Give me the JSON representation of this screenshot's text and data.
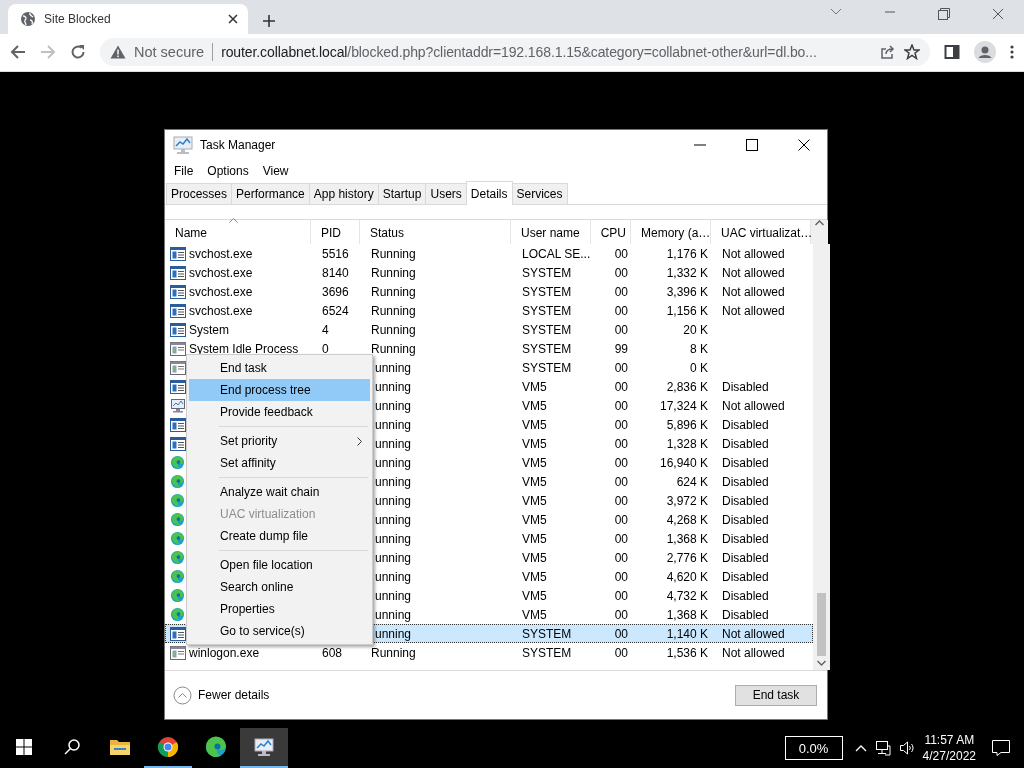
{
  "browser": {
    "tab": {
      "title": "Site Blocked"
    },
    "address_bar": {
      "security": "Not secure",
      "host": "router.collabnet.local",
      "path": "/blocked.php?clientaddr=192.168.1.15&category=collabnet-other&url=dl.bo..."
    }
  },
  "task_manager": {
    "title": "Task Manager",
    "menu": [
      "File",
      "Options",
      "View"
    ],
    "tabs": [
      {
        "label": "Processes",
        "selected": false
      },
      {
        "label": "Performance",
        "selected": false
      },
      {
        "label": "App history",
        "selected": false
      },
      {
        "label": "Startup",
        "selected": false
      },
      {
        "label": "Users",
        "selected": false
      },
      {
        "label": "Details",
        "selected": true
      },
      {
        "label": "Services",
        "selected": false
      }
    ],
    "columns": [
      "Name",
      "PID",
      "Status",
      "User name",
      "CPU",
      "Memory (a…",
      "UAC virtualizat…"
    ],
    "rows": [
      {
        "kind": "service",
        "name": "svchost.exe",
        "pid": "5516",
        "status": "Running",
        "user": "LOCAL SE...",
        "cpu": "00",
        "memory": "1,176 K",
        "uac": "Not allowed",
        "selected": false
      },
      {
        "kind": "service",
        "name": "svchost.exe",
        "pid": "8140",
        "status": "Running",
        "user": "SYSTEM",
        "cpu": "00",
        "memory": "1,332 K",
        "uac": "Not allowed",
        "selected": false
      },
      {
        "kind": "service",
        "name": "svchost.exe",
        "pid": "3696",
        "status": "Running",
        "user": "SYSTEM",
        "cpu": "00",
        "memory": "3,396 K",
        "uac": "Not allowed",
        "selected": false
      },
      {
        "kind": "service",
        "name": "svchost.exe",
        "pid": "6524",
        "status": "Running",
        "user": "SYSTEM",
        "cpu": "00",
        "memory": "1,156 K",
        "uac": "Not allowed",
        "selected": false
      },
      {
        "kind": "service",
        "name": "System",
        "pid": "4",
        "status": "Running",
        "user": "SYSTEM",
        "cpu": "00",
        "memory": "20 K",
        "selected": false
      },
      {
        "kind": "plain",
        "name": "System Idle Process",
        "pid": "0",
        "status": "Running",
        "user": "SYSTEM",
        "cpu": "99",
        "memory": "8 K",
        "selected": false
      },
      {
        "kind": "plain",
        "status": "unning",
        "user": "SYSTEM",
        "cpu": "00",
        "memory": "0 K",
        "selected": false
      },
      {
        "kind": "service",
        "status": "unning",
        "user": "VM5",
        "cpu": "00",
        "memory": "2,836 K",
        "uac": "Disabled",
        "selected": false
      },
      {
        "kind": "monitor",
        "status": "unning",
        "user": "VM5",
        "cpu": "00",
        "memory": "17,324 K",
        "uac": "Not allowed",
        "selected": false
      },
      {
        "kind": "service",
        "status": "unning",
        "user": "VM5",
        "cpu": "00",
        "memory": "5,896 K",
        "uac": "Disabled",
        "selected": false
      },
      {
        "kind": "service",
        "status": "unning",
        "user": "VM5",
        "cpu": "00",
        "memory": "1,328 K",
        "uac": "Disabled",
        "selected": false
      },
      {
        "kind": "swirl",
        "status": "unning",
        "user": "VM5",
        "cpu": "00",
        "memory": "16,940 K",
        "uac": "Disabled",
        "selected": false
      },
      {
        "kind": "swirl",
        "status": "unning",
        "user": "VM5",
        "cpu": "00",
        "memory": "624 K",
        "uac": "Disabled",
        "selected": false
      },
      {
        "kind": "swirl",
        "status": "unning",
        "user": "VM5",
        "cpu": "00",
        "memory": "3,972 K",
        "uac": "Disabled",
        "selected": false
      },
      {
        "kind": "swirl",
        "status": "unning",
        "user": "VM5",
        "cpu": "00",
        "memory": "4,268 K",
        "uac": "Disabled",
        "selected": false
      },
      {
        "kind": "swirl",
        "status": "unning",
        "user": "VM5",
        "cpu": "00",
        "memory": "1,368 K",
        "uac": "Disabled",
        "selected": false
      },
      {
        "kind": "swirl",
        "status": "unning",
        "user": "VM5",
        "cpu": "00",
        "memory": "2,776 K",
        "uac": "Disabled",
        "selected": false
      },
      {
        "kind": "swirl",
        "status": "unning",
        "user": "VM5",
        "cpu": "00",
        "memory": "4,620 K",
        "uac": "Disabled",
        "selected": false
      },
      {
        "kind": "swirl",
        "status": "unning",
        "user": "VM5",
        "cpu": "00",
        "memory": "4,732 K",
        "uac": "Disabled",
        "selected": false
      },
      {
        "kind": "swirl",
        "status": "unning",
        "user": "VM5",
        "cpu": "00",
        "memory": "1,368 K",
        "uac": "Disabled",
        "selected": false
      },
      {
        "kind": "service",
        "status": "unning",
        "user": "SYSTEM",
        "cpu": "00",
        "memory": "1,140 K",
        "uac": "Not allowed",
        "selected": true
      },
      {
        "kind": "plain",
        "name": "winlogon.exe",
        "pid": "608",
        "status": "Running",
        "user": "SYSTEM",
        "cpu": "00",
        "memory": "1,536 K",
        "uac": "Not allowed",
        "selected": false
      }
    ],
    "context_menu": [
      {
        "kind": "item",
        "label": "End task",
        "selected": false,
        "disabled": false
      },
      {
        "kind": "item",
        "label": "End process tree",
        "selected": true,
        "disabled": false
      },
      {
        "kind": "item",
        "label": "Provide feedback",
        "selected": false,
        "disabled": false
      },
      {
        "kind": "separator"
      },
      {
        "kind": "item",
        "label": "Set priority",
        "selected": false,
        "disabled": false,
        "submenu": true
      },
      {
        "kind": "item",
        "label": "Set affinity",
        "selected": false,
        "disabled": false
      },
      {
        "kind": "separator"
      },
      {
        "kind": "item",
        "label": "Analyze wait chain",
        "selected": false,
        "disabled": false
      },
      {
        "kind": "item",
        "label": "UAC virtualization",
        "selected": false,
        "disabled": true
      },
      {
        "kind": "item",
        "label": "Create dump file",
        "selected": false,
        "disabled": false
      },
      {
        "kind": "separator"
      },
      {
        "kind": "item",
        "label": "Open file location",
        "selected": false,
        "disabled": false
      },
      {
        "kind": "item",
        "label": "Search online",
        "selected": false,
        "disabled": false
      },
      {
        "kind": "item",
        "label": "Properties",
        "selected": false,
        "disabled": false
      },
      {
        "kind": "item",
        "label": "Go to service(s)",
        "selected": false,
        "disabled": false
      }
    ],
    "fewer_details": "Fewer details",
    "end_task_button": "End task"
  },
  "taskbar": {
    "apps": [
      {
        "kind": "folder",
        "running": false,
        "active": false
      },
      {
        "kind": "chrome",
        "running": true,
        "active": false
      },
      {
        "kind": "edge",
        "running": false,
        "active": false
      },
      {
        "kind": "monitor",
        "running": true,
        "active": true
      }
    ],
    "cpu_reading": "0.0%",
    "time": "11:57 AM",
    "date": "4/27/2022"
  }
}
